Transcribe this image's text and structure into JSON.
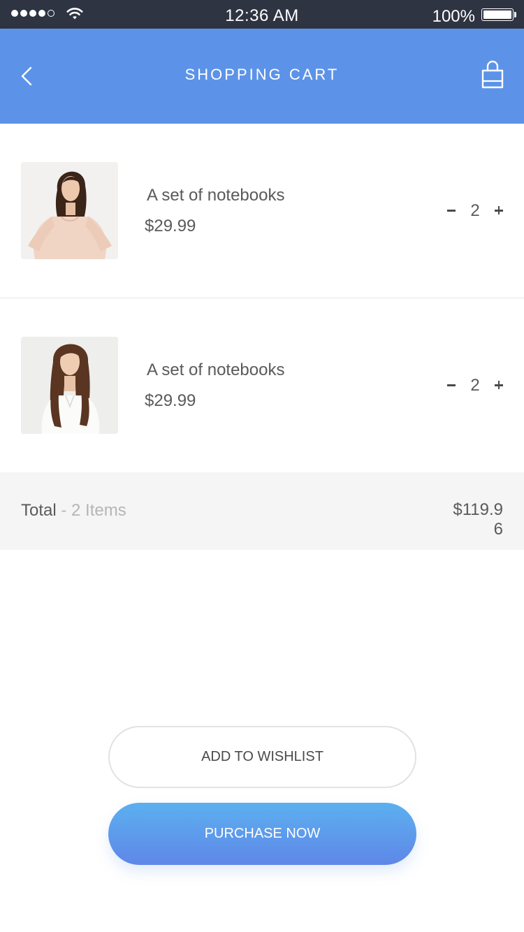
{
  "status_bar": {
    "time": "12:36 AM",
    "battery_percent": "100%",
    "signal_bars": 4,
    "signal_max": 5
  },
  "header": {
    "title": "SHOPPING CART",
    "background_color": "#5c93e8",
    "back_icon": "chevron-left-icon",
    "bag_icon": "shopping-bag-icon"
  },
  "cart": {
    "items": [
      {
        "name": "A set of notebooks",
        "price": "$29.99",
        "quantity": "2",
        "image": "product-photo-woman-pink-blouse"
      },
      {
        "name": "A set of notebooks",
        "price": "$29.99",
        "quantity": "2",
        "image": "product-photo-woman-white-top"
      }
    ]
  },
  "summary": {
    "total_label": "Total",
    "item_count": "- 2 Items",
    "total_amount": "$119.96"
  },
  "actions": {
    "wishlist_label": "ADD TO WISHLIST",
    "purchase_label": "PURCHASE NOW",
    "purchase_gradient": [
      "#5cb0ef",
      "#5f87e8"
    ]
  }
}
